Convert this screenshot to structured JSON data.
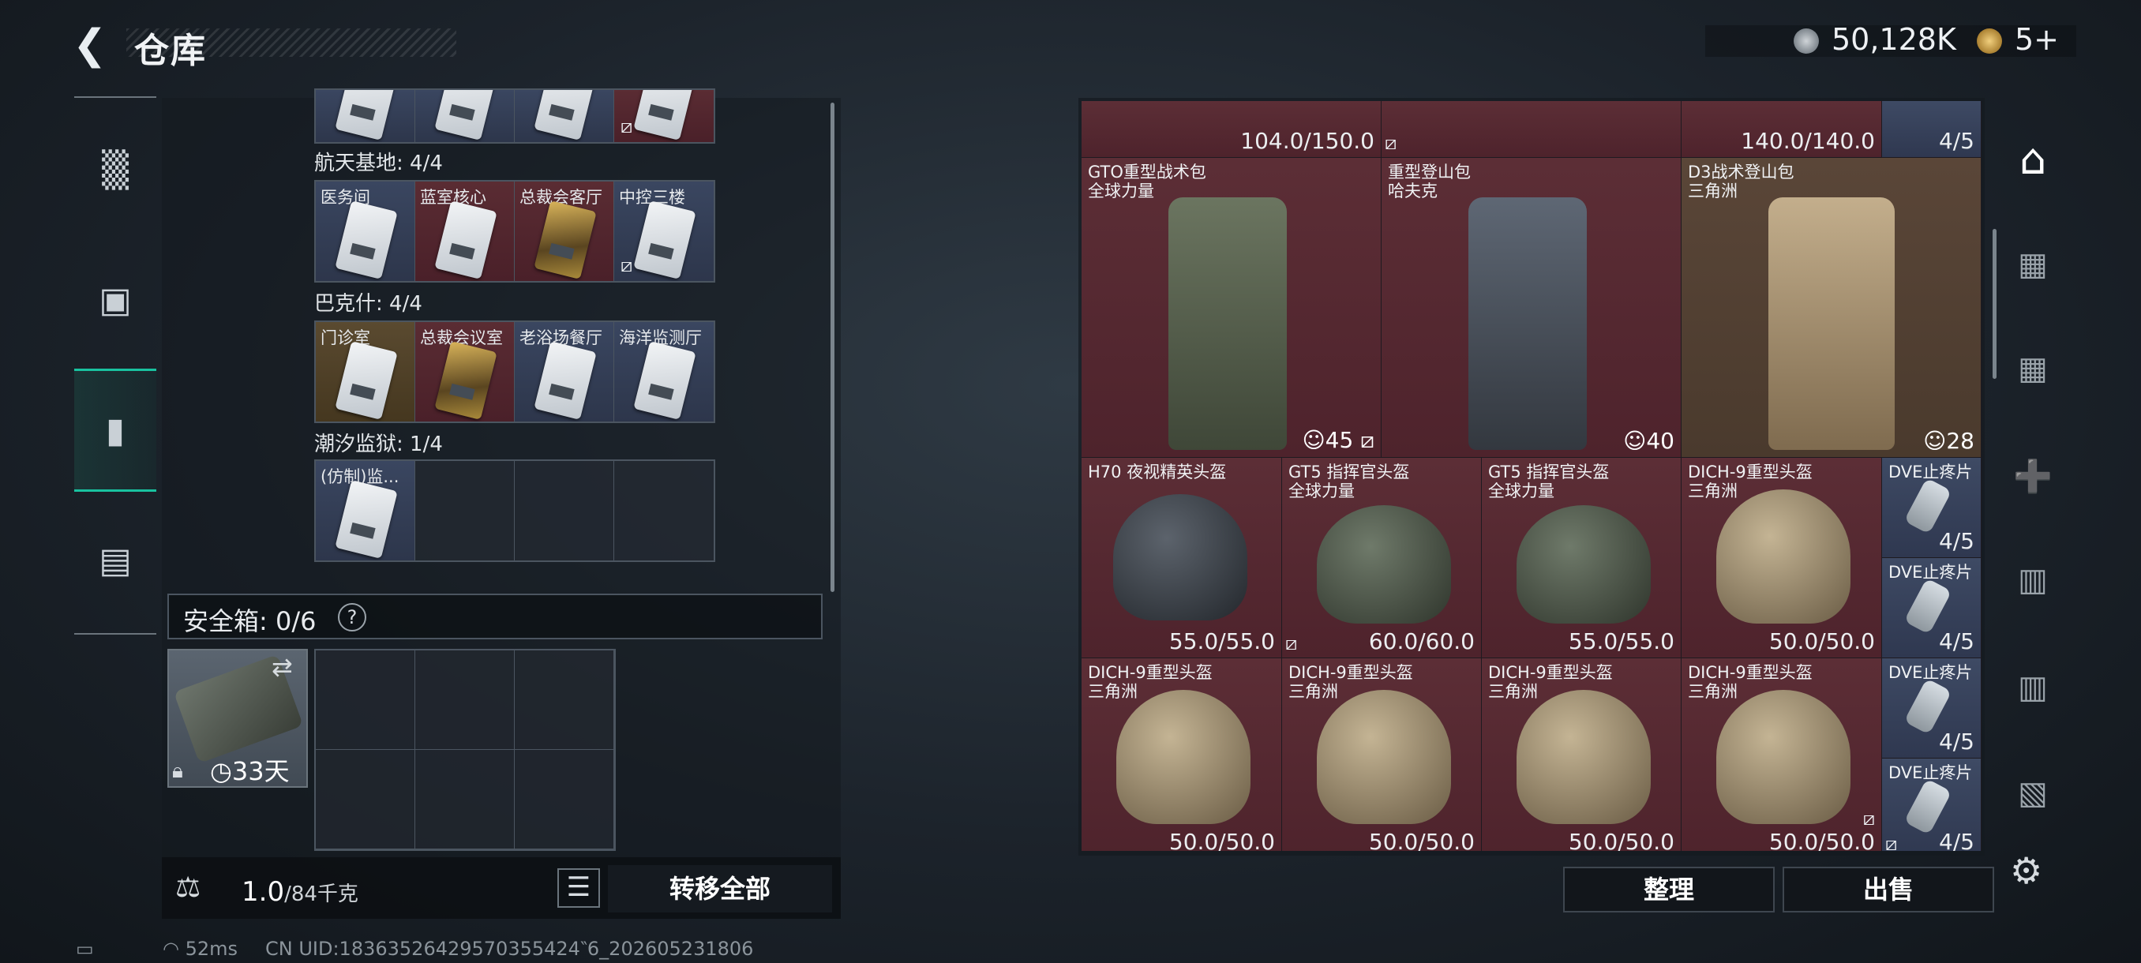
{
  "header": {
    "back_icon": "back-arrow-icon",
    "title": "仓库",
    "currency1_value": "50,128K",
    "currency2_value": "5+"
  },
  "left_nav": {
    "tabs": [
      "weapon-tab-icon",
      "armor-tab-icon",
      "backpack-tab-icon",
      "toolbox-tab-icon"
    ],
    "active_index": 2
  },
  "keys": {
    "partial_row": [
      "",
      "",
      "",
      ""
    ],
    "sections": [
      {
        "title": "航天基地: 4/4",
        "items": [
          {
            "name": "医务间",
            "color": "blue"
          },
          {
            "name": "蓝室核心",
            "color": "red"
          },
          {
            "name": "总裁会客厅",
            "color": "red"
          },
          {
            "name": "中控三楼",
            "color": "blue"
          }
        ]
      },
      {
        "title": "巴克什: 4/4",
        "items": [
          {
            "name": "门诊室",
            "color": "gold"
          },
          {
            "name": "总裁会议室",
            "color": "red"
          },
          {
            "name": "老浴场餐厅",
            "color": "blue"
          },
          {
            "name": "海洋监测厅",
            "color": "blue"
          }
        ]
      },
      {
        "title": "潮汐监狱: 1/4",
        "items": [
          {
            "name": "(仿制)监...",
            "color": "blue"
          }
        ]
      }
    ]
  },
  "safe": {
    "label": "安全箱: 0/6",
    "help": "?",
    "days": "33天"
  },
  "bottom_left": {
    "weight_value": "1.0",
    "weight_unit": "/84千克",
    "list_icon": "list-icon",
    "transfer_label": "转移全部"
  },
  "status": {
    "ping": "52ms",
    "uid": "CN UID:18363526429570355424‶6_202605231806"
  },
  "stash": {
    "top_row": {
      "dur1": "104.0/150.0",
      "dur2": "140.0/140.0",
      "cnt": "4/5"
    },
    "backpacks": [
      {
        "name": "GTO重型战术包",
        "maker": "全球力量",
        "level": "45"
      },
      {
        "name": "重型登山包",
        "maker": "哈夫克",
        "level": "40"
      },
      {
        "name": "D3战术登山包",
        "maker": "三角洲",
        "level": "28"
      }
    ],
    "helmets_row1": [
      {
        "name": "H70 夜视精英头盔",
        "maker": "",
        "dur": "55.0/55.0"
      },
      {
        "name": "GT5 指挥官头盔",
        "maker": "全球力量",
        "dur": "60.0/60.0"
      },
      {
        "name": "GT5 指挥官头盔",
        "maker": "全球力量",
        "dur": "55.0/55.0"
      },
      {
        "name": "DICH-9重型头盔",
        "maker": "三角洲",
        "dur": "50.0/50.0"
      }
    ],
    "helmets_row2": [
      {
        "name": "DICH-9重型头盔",
        "maker": "三角洲",
        "dur": "50.0/50.0"
      },
      {
        "name": "DICH-9重型头盔",
        "maker": "三角洲",
        "dur": "50.0/50.0"
      },
      {
        "name": "DICH-9重型头盔",
        "maker": "三角洲",
        "dur": "50.0/50.0"
      },
      {
        "name": "DICH-9重型头盔",
        "maker": "三角洲",
        "dur": "50.0/50.0"
      }
    ],
    "meds": [
      {
        "name": "DVE止疼片",
        "cnt": "4/5"
      },
      {
        "name": "DVE止疼片",
        "cnt": "4/5"
      },
      {
        "name": "DVE止疼片",
        "cnt": "4/5"
      },
      {
        "name": "DVE止疼片",
        "cnt": "4/5"
      }
    ]
  },
  "right_nav": {
    "tabs": [
      "stash-tab-icon",
      "folder-1-icon",
      "folder-2-icon",
      "tier-iv-icon",
      "tier-iii-icon",
      "tier-iii-b-icon",
      "tier-v-icon"
    ]
  },
  "actions": {
    "sort_label": "整理",
    "sell_label": "出售",
    "settings_icon": "gear-icon"
  }
}
